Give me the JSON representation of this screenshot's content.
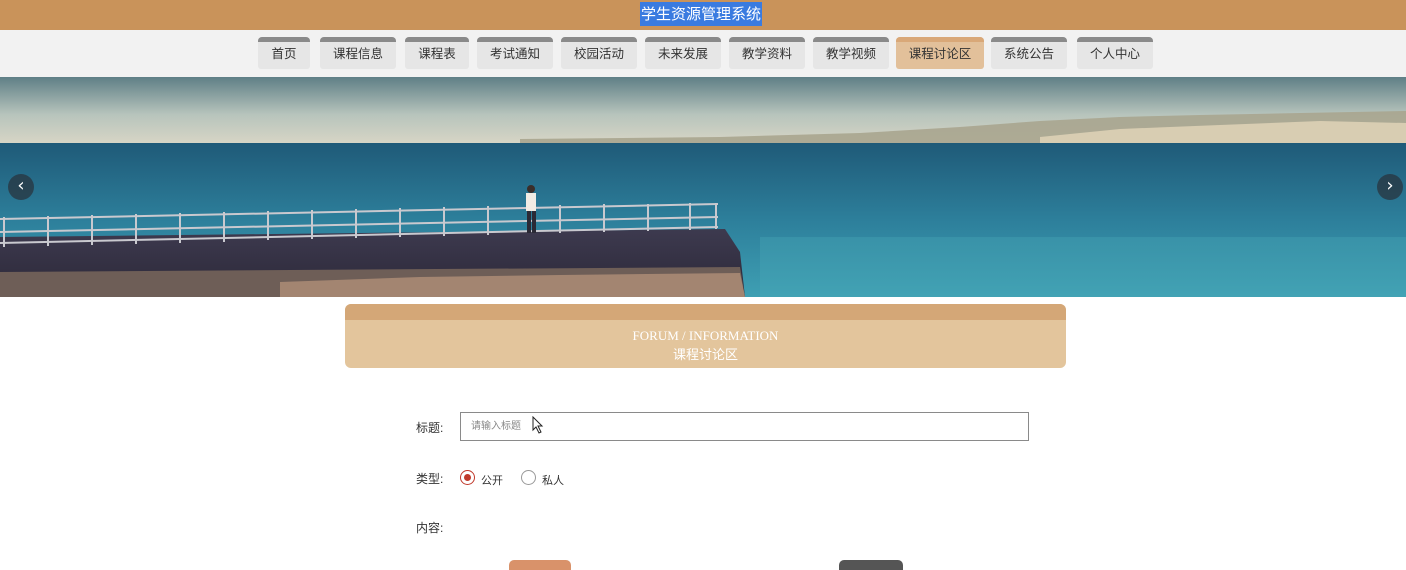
{
  "app": {
    "title": "学生资源管理系统"
  },
  "nav": {
    "items": [
      {
        "label": "首页",
        "active": false
      },
      {
        "label": "课程信息",
        "active": false
      },
      {
        "label": "课程表",
        "active": false
      },
      {
        "label": "考试通知",
        "active": false
      },
      {
        "label": "校园活动",
        "active": false
      },
      {
        "label": "未来发展",
        "active": false
      },
      {
        "label": "教学资料",
        "active": false
      },
      {
        "label": "教学视频",
        "active": false
      },
      {
        "label": "课程讨论区",
        "active": true
      },
      {
        "label": "系统公告",
        "active": false
      },
      {
        "label": "个人中心",
        "active": false
      }
    ]
  },
  "banner": {
    "prev_icon": "chevron-left-icon",
    "next_icon": "chevron-right-icon",
    "prev_glyph": "‹",
    "next_glyph": "›"
  },
  "section": {
    "title_en": "FORUM / INFORMATION",
    "title_cn": "课程讨论区"
  },
  "form": {
    "title_label": "标题:",
    "title_placeholder": "请输入标题",
    "title_value": "",
    "type_label": "类型:",
    "type_options": [
      {
        "label": "公开",
        "checked": true
      },
      {
        "label": "私人",
        "checked": false
      }
    ],
    "content_label": "内容:"
  },
  "colors": {
    "topbar": "#c9935a",
    "active_tab": "#e2c09a",
    "section_header": "#e3c59c",
    "radio_checked": "#c0392b",
    "submit_button": "#d9926a",
    "reset_button": "#555555"
  }
}
